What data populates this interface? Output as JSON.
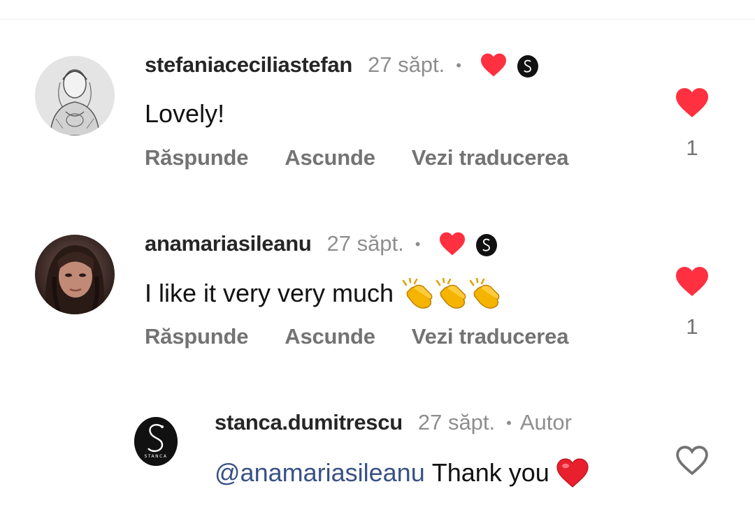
{
  "comments": [
    {
      "username": "stefaniaceciliastefan",
      "time": "27 săpt.",
      "separator": "•",
      "text": "Lovely!",
      "actions": {
        "reply": "Răspunde",
        "hide": "Ascunde",
        "translate": "Vezi traducerea"
      },
      "like_count": "1",
      "liked": true,
      "liked_by_author": true,
      "avatar_icon": "sketch-portrait-avatar"
    },
    {
      "username": "anamariasileanu",
      "time": "27 săpt.",
      "separator": "•",
      "text": "I like it very very much",
      "emoji": [
        "clapping-hands",
        "clapping-hands",
        "clapping-hands"
      ],
      "actions": {
        "reply": "Răspunde",
        "hide": "Ascunde",
        "translate": "Vezi traducerea"
      },
      "like_count": "1",
      "liked": true,
      "liked_by_author": true,
      "avatar_icon": "photo-portrait-avatar"
    },
    {
      "username": "stanca.dumitrescu",
      "time": "27 săpt.",
      "separator": "•",
      "author_label": "Autor",
      "mention": "@anamariasileanu",
      "text": "Thank you",
      "emoji": [
        "red-heart"
      ],
      "liked": false,
      "avatar_icon": "stanca-logo-avatar",
      "logo_text": "STANCA"
    }
  ],
  "colors": {
    "like_red": "#ff3040",
    "mention_blue": "#385185",
    "secondary_text": "#8e8e8e",
    "action_text": "#737373"
  }
}
